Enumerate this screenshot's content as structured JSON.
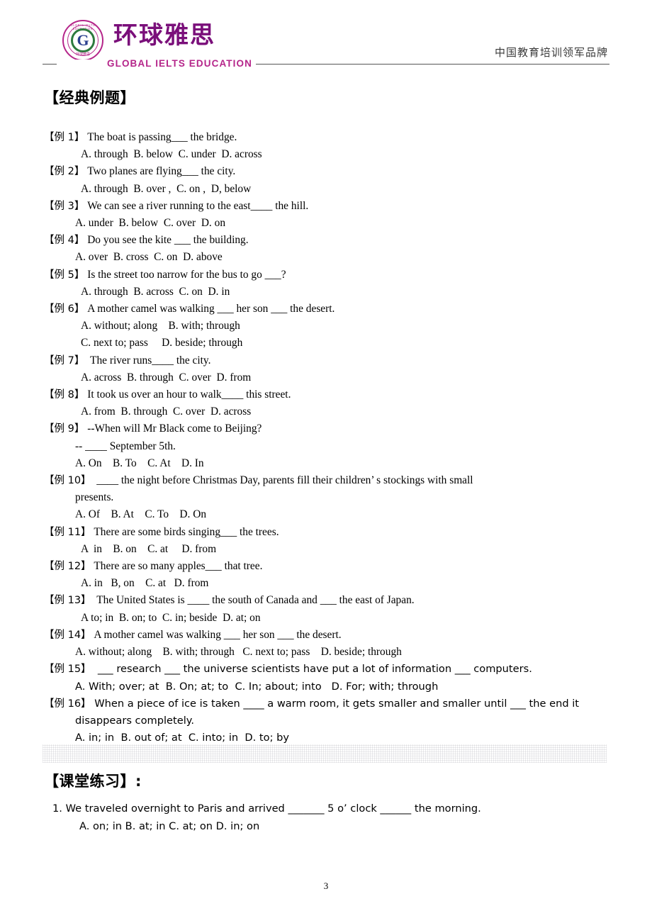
{
  "header": {
    "brand_cn": "环球雅思",
    "brand_en": "GLOBAL IELTS EDUCATION",
    "seal_arc_top": "GLOBAL IELTS EDUCATION",
    "seal_arc_bottom": "环球雅思",
    "seal_letter": "G",
    "tagline": "中国教育培训领军品牌"
  },
  "sections": {
    "classic_title": "【经典例题】",
    "practice_title": "【课堂练习】:"
  },
  "examples": [
    {
      "tag": "【例 1】",
      "stem": " The boat is passing___ the bridge.",
      "options": "A. through  B. below  C. under  D. across",
      "font": "serif",
      "opts_indent": "deep"
    },
    {
      "tag": "【例 2】",
      "stem": " Two planes are flying___ the city.",
      "options": "A. through  B. over ,  C. on ,  D, below",
      "font": "serif",
      "opts_indent": "deep"
    },
    {
      "tag": "【例 3】",
      "stem": " We can see a river running to the east____ the hill.",
      "options": "A. under  B. below  C. over  D. on",
      "font": "serif",
      "opts_indent": "normal"
    },
    {
      "tag": "【例 4】",
      "stem": " Do you see the kite ___ the building.",
      "options": "A. over  B. cross  C. on  D. above",
      "font": "serif",
      "opts_indent": "normal"
    },
    {
      "tag": "【例 5】",
      "stem": " Is the street too narrow for the bus to go ___?",
      "options": "A. through  B. across  C. on  D. in",
      "font": "serif",
      "opts_indent": "deep"
    },
    {
      "tag": "【例 6】",
      "stem": " A mother camel was walking ___ her son ___ the desert.",
      "options": "A. without; along    B. with; through",
      "options2": "C. next to; pass     D. beside; through",
      "font": "serif",
      "opts_indent": "deep"
    },
    {
      "tag": "【例 7】",
      "stem": "  The river runs____ the city.",
      "options": "A. across  B. through  C. over  D. from",
      "font": "serif",
      "opts_indent": "deep"
    },
    {
      "tag": "【例 8】",
      "stem": " It took us over an hour to walk____ this street.",
      "options": "A. from  B. through  C. over  D. across",
      "font": "serif",
      "opts_indent": "deep"
    },
    {
      "tag": "【例 9】",
      "stem": " --When will Mr Black come to Beijing?",
      "continuation": "-- ____ September 5th.",
      "options": "A. On    B. To    C. At    D. In",
      "font": "serif",
      "opts_indent": "normal"
    },
    {
      "tag": "【例 10】",
      "stem": "  ____ the night before Christmas Day, parents fill their children’ s stockings with small",
      "continuation": "presents.",
      "options": "A. Of    B. At    C. To    D. On",
      "font": "serif",
      "opts_indent": "normal"
    },
    {
      "tag": "【例 11】",
      "stem": " There are some birds singing___ the trees.",
      "options": "A  in    B. on    C. at     D. from",
      "font": "serif",
      "opts_indent": "deep"
    },
    {
      "tag": "【例 12】",
      "stem": " There are so many apples___ that tree.",
      "options": "A. in   B, on    C. at   D. from",
      "font": "serif",
      "opts_indent": "deep"
    },
    {
      "tag": "【例 13】",
      "stem": "  The United States is ____ the south of Canada and ___ the east of Japan.",
      "options": "A to; in  B. on; to  C. in; beside  D. at; on",
      "font": "serif",
      "opts_indent": "deep"
    },
    {
      "tag": "【例 14】",
      "stem": " A mother camel was walking ___ her son ___ the desert.",
      "options": "A. without; along    B. with; through   C. next to; pass    D. beside; through",
      "font": "serif",
      "opts_indent": "normal"
    },
    {
      "tag": "【例 15】",
      "stem": "  ___ research ___ the universe scientists have put a lot of information ___ computers.",
      "options": "A. With; over; at  B. On; at; to  C. In; about; into   D. For; with; through",
      "font": "sans",
      "opts_indent": "normal"
    },
    {
      "tag": "【例 16】",
      "stem": " When a piece of ice is taken ____ a warm room, it gets smaller and smaller until ___ the end it",
      "continuation": "disappears completely.",
      "options": "A. in; in  B. out of; at  C. into; in  D. to; by",
      "font": "sans",
      "opts_indent": "normal"
    }
  ],
  "practice_items": [
    {
      "stem": "1. We traveled overnight to Paris and arrived _______ 5 o’ clock ______ the morning.",
      "options": "A. on; in  B. at; in  C. at; on  D. in; on"
    }
  ],
  "footer": {
    "page_number": "3"
  }
}
